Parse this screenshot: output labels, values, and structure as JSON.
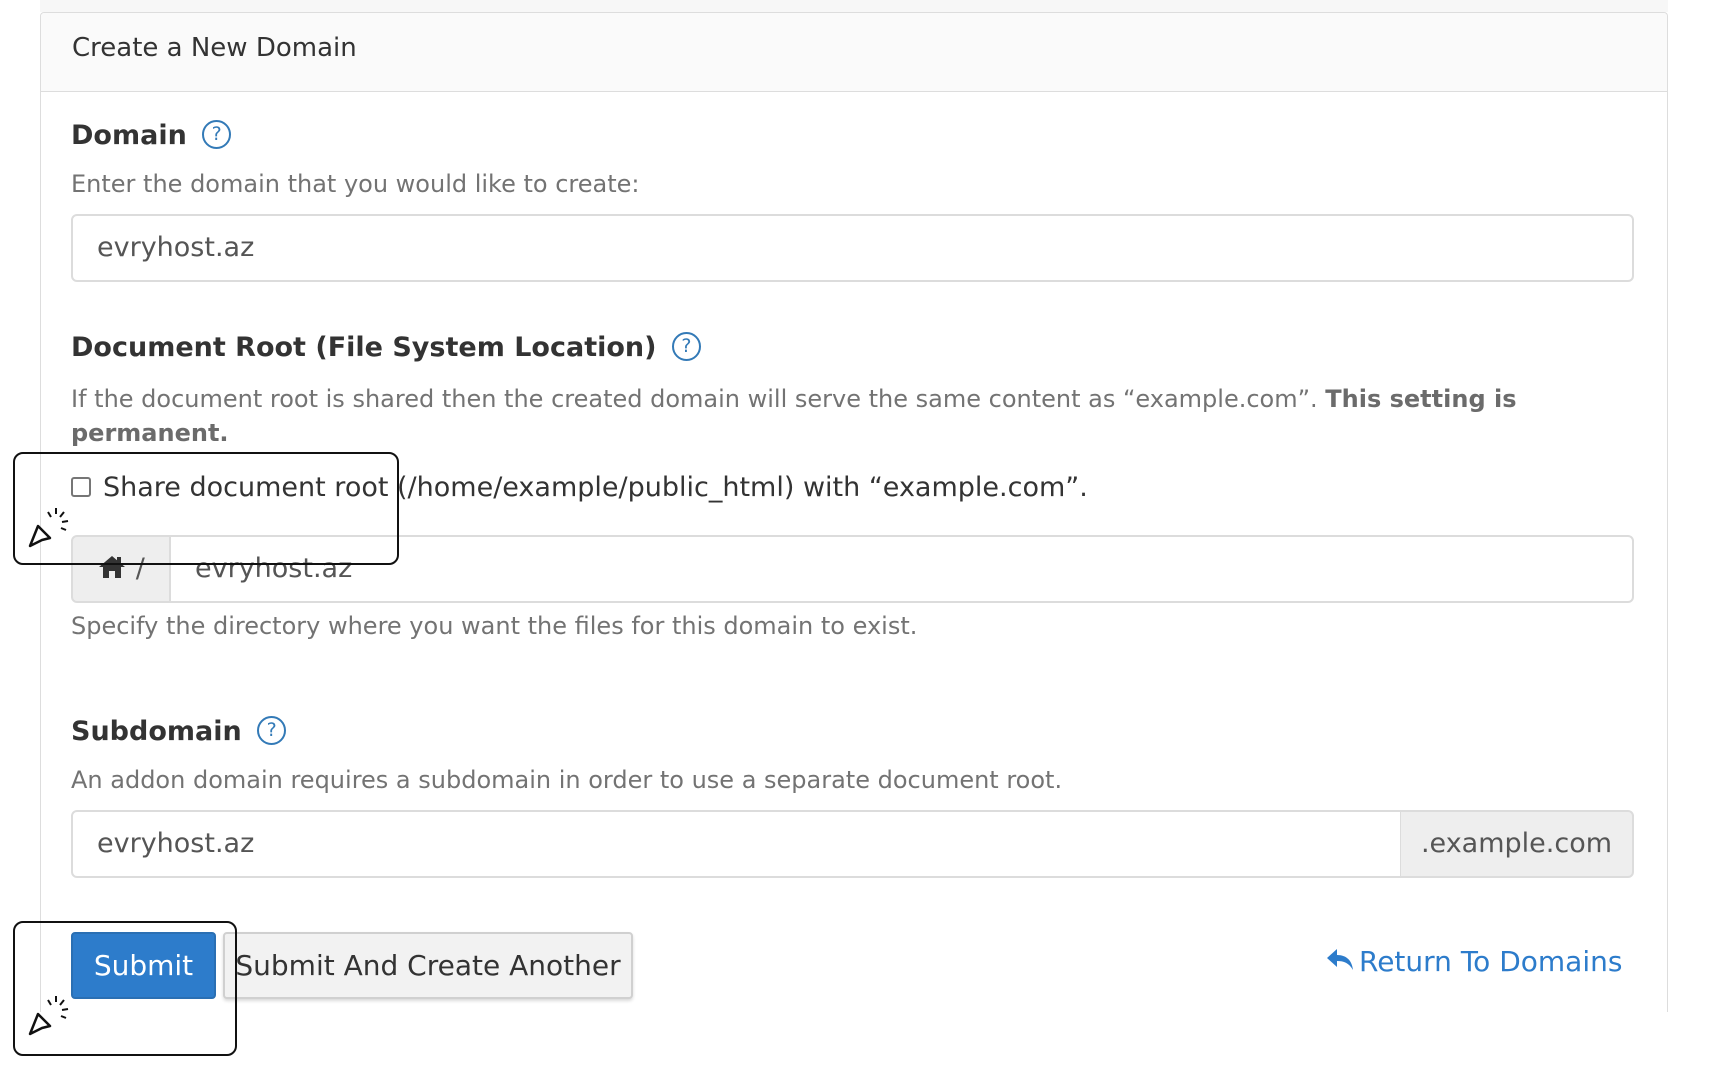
{
  "panel": {
    "title": "Create a New Domain"
  },
  "domain": {
    "label": "Domain",
    "help_icon": "question-circle-icon",
    "description": "Enter the domain that you would like to create:",
    "value": "evryhost.az"
  },
  "document_root": {
    "label": "Document Root (File System Location)",
    "help_icon": "question-circle-icon",
    "description_plain": "If the document root is shared then the created domain will serve the same content as “example.com”. ",
    "description_bold_1": "This setting is",
    "description_bold_2": "permanent.",
    "checkbox_label": "Share document root (/home/example/public_html) with “example.com”.",
    "checkbox_checked": false,
    "path_prefix": "/",
    "path_icon": "home-icon",
    "value": "evryhost.az",
    "hint": "Specify the directory where you want the files for this domain to exist."
  },
  "subdomain": {
    "label": "Subdomain",
    "help_icon": "question-circle-icon",
    "description": "An addon domain requires a subdomain in order to use a separate document root.",
    "value": "evryhost.az",
    "suffix": ".example.com"
  },
  "actions": {
    "submit_label": "Submit",
    "submit_another_label": "Submit And Create Another",
    "return_label": "Return To Domains",
    "return_icon": "reply-icon"
  },
  "colors": {
    "primary": "#2d7ccb",
    "link": "#2d7ccb",
    "help": "#337ab7",
    "muted_text": "#737373",
    "border": "#dcdcdc"
  }
}
